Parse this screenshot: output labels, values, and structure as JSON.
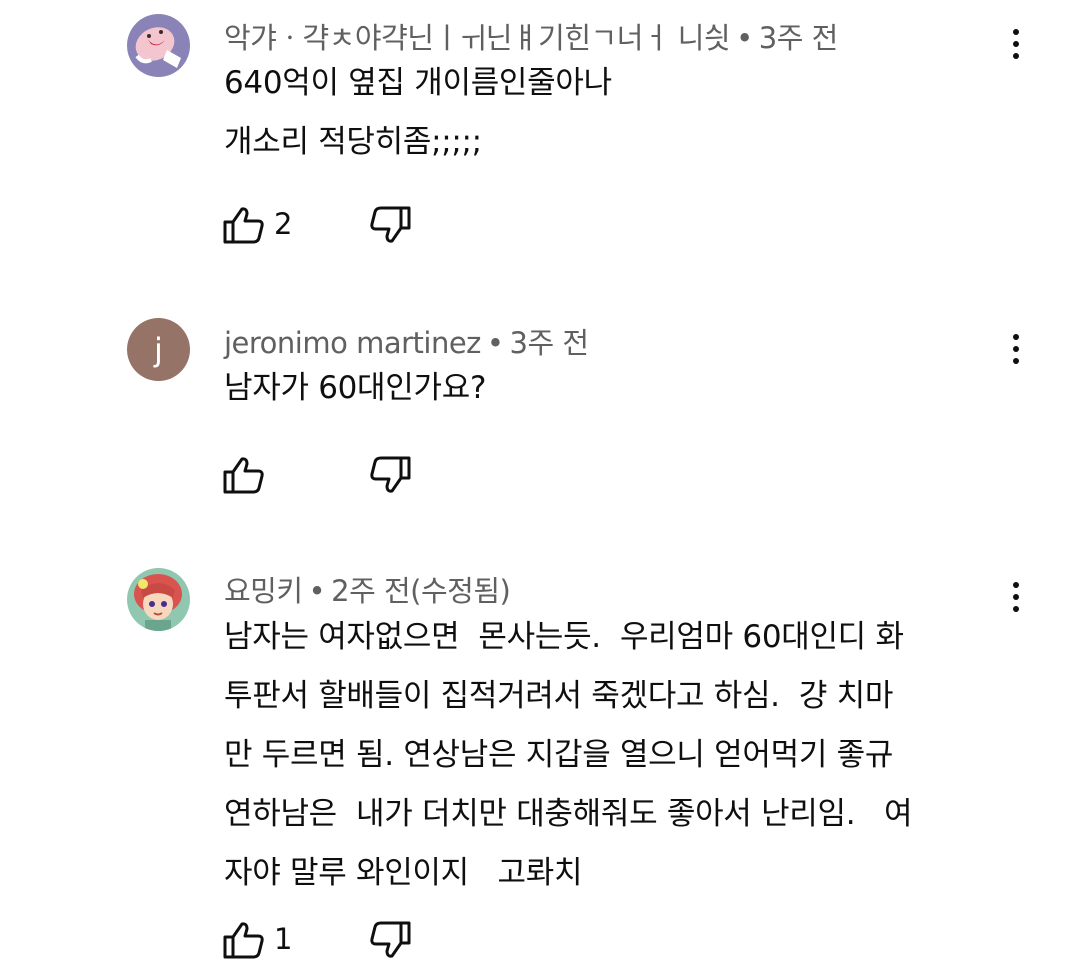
{
  "comments": [
    {
      "author": "악갸ㆍ갹ㅊ야갹닌ㅣㅟ닌ㅒ기힌ㄱ너ㅓ 니싓",
      "separator": "•",
      "time": "3주 전",
      "lines": [
        "640억이 옆집 개이름인줄아나",
        "개소리 적당히좀;;;;;"
      ],
      "likes": "2",
      "avatar_icon": "cartoon-character-avatar-icon",
      "avatar_color": "#8a83b8"
    },
    {
      "author": "jeronimo martinez",
      "separator": "•",
      "time": "3주 전",
      "lines": [
        "남자가 60대인가요?"
      ],
      "likes": "",
      "avatar_letter": "j",
      "avatar_color": "#957366"
    },
    {
      "author": "요밍키",
      "separator": "•",
      "time": "2주 전(수정됨)",
      "lines": [
        "남자는 여자없으면  몬사는듯.  우리엄마 60대인디 화",
        "투판서 할배들이 집적거려서 죽겠다고 하심.  걍 치마",
        "만 두르면 됨. 연상남은 지갑을 열으니 얻어먹기 좋규",
        "연하남은  내가 더치만 대충해줘도 좋아서 난리임.   여",
        "자야 말루 와인이지   고롸치"
      ],
      "likes": "1",
      "avatar_icon": "anime-girl-avatar-icon",
      "avatar_color": "#8fc7b0"
    }
  ]
}
